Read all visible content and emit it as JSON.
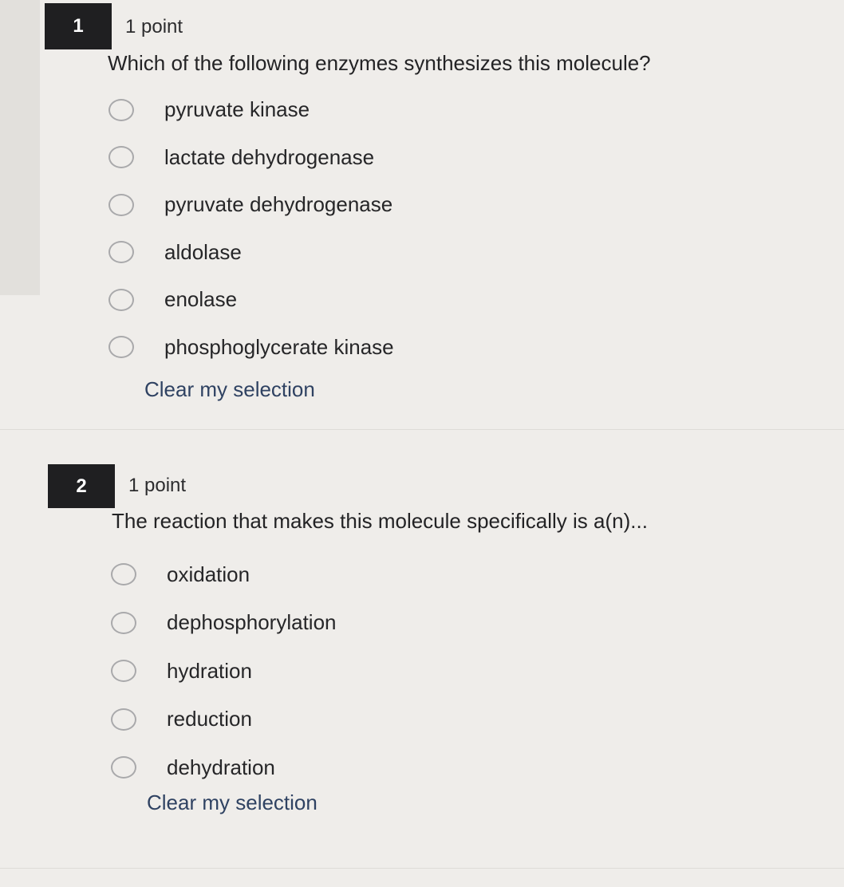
{
  "questions": [
    {
      "number": "1",
      "points": "1 point",
      "text": "Which of the following enzymes synthesizes this molecule?",
      "options": [
        "pyruvate kinase",
        "lactate dehydrogenase",
        "pyruvate dehydrogenase",
        "aldolase",
        "enolase",
        "phosphoglycerate kinase"
      ],
      "clear_label": "Clear my selection"
    },
    {
      "number": "2",
      "points": "1 point",
      "text": "The reaction that makes this molecule specifically is a(n)...",
      "options": [
        "oxidation",
        "dephosphorylation",
        "hydration",
        "reduction",
        "dehydration"
      ],
      "clear_label": "Clear my selection"
    }
  ],
  "colors": {
    "background": "#efedea",
    "number_badge": "#1f1f21",
    "link": "#2f4262",
    "radio_border": "#a9a9ab"
  }
}
